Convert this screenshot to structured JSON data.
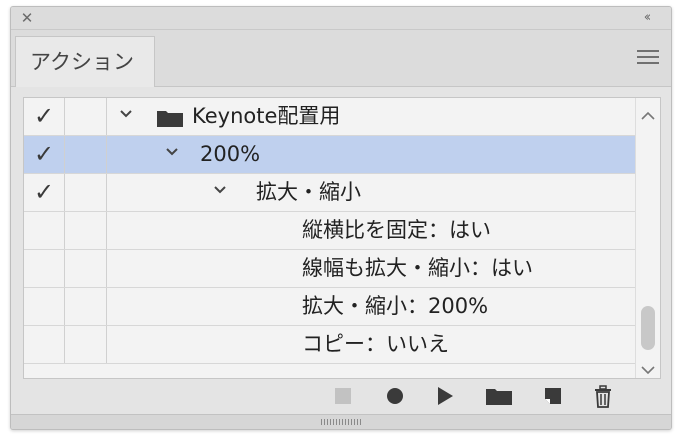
{
  "panel": {
    "tab_label": "アクション",
    "close_symbol": "✕",
    "collapse_symbol": "‹‹"
  },
  "rows": [
    {
      "check": "✓",
      "label": "Keynote配置用",
      "type": "set",
      "expanded": true
    },
    {
      "check": "✓",
      "label": "200%",
      "type": "action",
      "expanded": true,
      "selected": true
    },
    {
      "check": "✓",
      "label": "拡大・縮小",
      "type": "step",
      "expanded": true
    },
    {
      "check": "",
      "label": "縦横比を固定：はい",
      "type": "detail"
    },
    {
      "check": "",
      "label": "線幅も拡大・縮小：はい",
      "type": "detail"
    },
    {
      "check": "",
      "label": "拡大・縮小：200%",
      "type": "detail"
    },
    {
      "check": "",
      "label": "コピー：いいえ",
      "type": "detail"
    }
  ],
  "toolbar": {
    "icons": [
      "stop-icon",
      "record-icon",
      "play-icon",
      "new-set-folder-icon",
      "new-action-icon",
      "trash-icon"
    ]
  },
  "colors": {
    "selected_row": "#bfd0ee",
    "panel_bg": "#e4e4e4",
    "list_bg": "#f3f3f3"
  }
}
